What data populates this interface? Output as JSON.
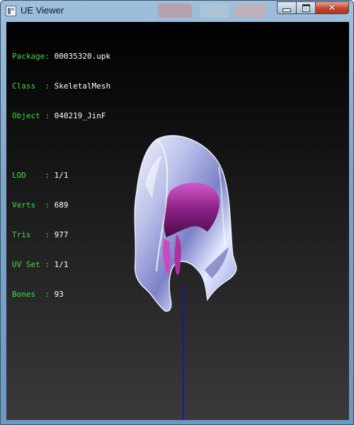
{
  "window": {
    "title": "UE Viewer",
    "icon": "app-icon",
    "controls": {
      "minimize": "minimize-icon",
      "maximize": "maximize-icon",
      "close": "close-icon",
      "close_glyph": "✕"
    }
  },
  "info_rows": [
    {
      "key": "Package",
      "sep": ": ",
      "value": "00035320.upk"
    },
    {
      "key": "Class  ",
      "sep": ": ",
      "value": "SkeletalMesh"
    },
    {
      "key": "Object ",
      "sep": ": ",
      "value": "040219_JinF"
    }
  ],
  "stats_rows": [
    {
      "key": "LOD    ",
      "sep": ": ",
      "value": "1/1"
    },
    {
      "key": "Verts  ",
      "sep": ": ",
      "value": "689"
    },
    {
      "key": "Tris   ",
      "sep": ": ",
      "value": "977"
    },
    {
      "key": "UV Set ",
      "sep": ": ",
      "value": "1/1"
    },
    {
      "key": "Bones  ",
      "sep": ": ",
      "value": "93"
    }
  ],
  "colors": {
    "label_green": "#41d941",
    "value_white": "#ffffff",
    "bone_axis": "#1a1aa0",
    "mesh_silver": "#c8cdf0",
    "mesh_purple": "#a0309a"
  }
}
